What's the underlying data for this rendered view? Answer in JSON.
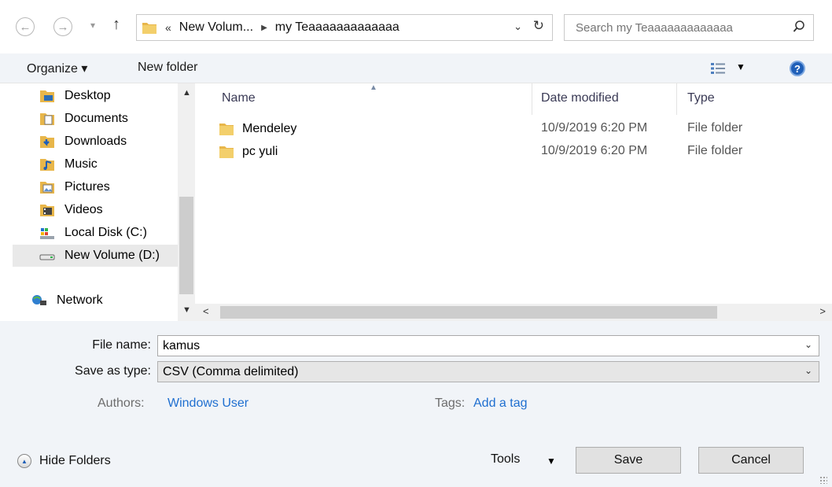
{
  "address_bar": {
    "crumbs": [
      "New Volum...",
      "my Teaaaaaaaaaaaaa"
    ],
    "search_placeholder": "Search my Teaaaaaaaaaaaaa"
  },
  "toolbar": {
    "organize_label": "Organize ▾",
    "new_folder_label": "New folder"
  },
  "nav_pane": {
    "items": [
      {
        "label": "Desktop",
        "icon": "desktop-folder-icon"
      },
      {
        "label": "Documents",
        "icon": "documents-folder-icon"
      },
      {
        "label": "Downloads",
        "icon": "downloads-folder-icon"
      },
      {
        "label": "Music",
        "icon": "music-folder-icon"
      },
      {
        "label": "Pictures",
        "icon": "pictures-folder-icon"
      },
      {
        "label": "Videos",
        "icon": "videos-folder-icon"
      },
      {
        "label": "Local Disk (C:)",
        "icon": "local-disk-icon"
      },
      {
        "label": "New Volume (D:)",
        "icon": "drive-icon",
        "selected": true
      }
    ],
    "network_label": "Network"
  },
  "file_list": {
    "columns": [
      "Name",
      "Date modified",
      "Type"
    ],
    "rows": [
      {
        "name": "Mendeley",
        "date": "10/9/2019 6:20 PM",
        "type": "File folder"
      },
      {
        "name": "pc yuli",
        "date": "10/9/2019 6:20 PM",
        "type": "File folder"
      }
    ]
  },
  "form": {
    "file_name_label": "File name:",
    "file_name_value": "kamus",
    "save_type_label": "Save as type:",
    "save_type_value": "CSV (Comma delimited)",
    "authors_label": "Authors:",
    "authors_value": "Windows User",
    "tags_label": "Tags:",
    "tags_value": "Add a tag"
  },
  "footer": {
    "hide_folders_label": "Hide Folders",
    "tools_label": "Tools",
    "save_label": "Save",
    "cancel_label": "Cancel"
  },
  "colors": {
    "toolbar_bg": "#f1f4f8",
    "link": "#1f6fd0",
    "folder": "#e8b64a"
  }
}
